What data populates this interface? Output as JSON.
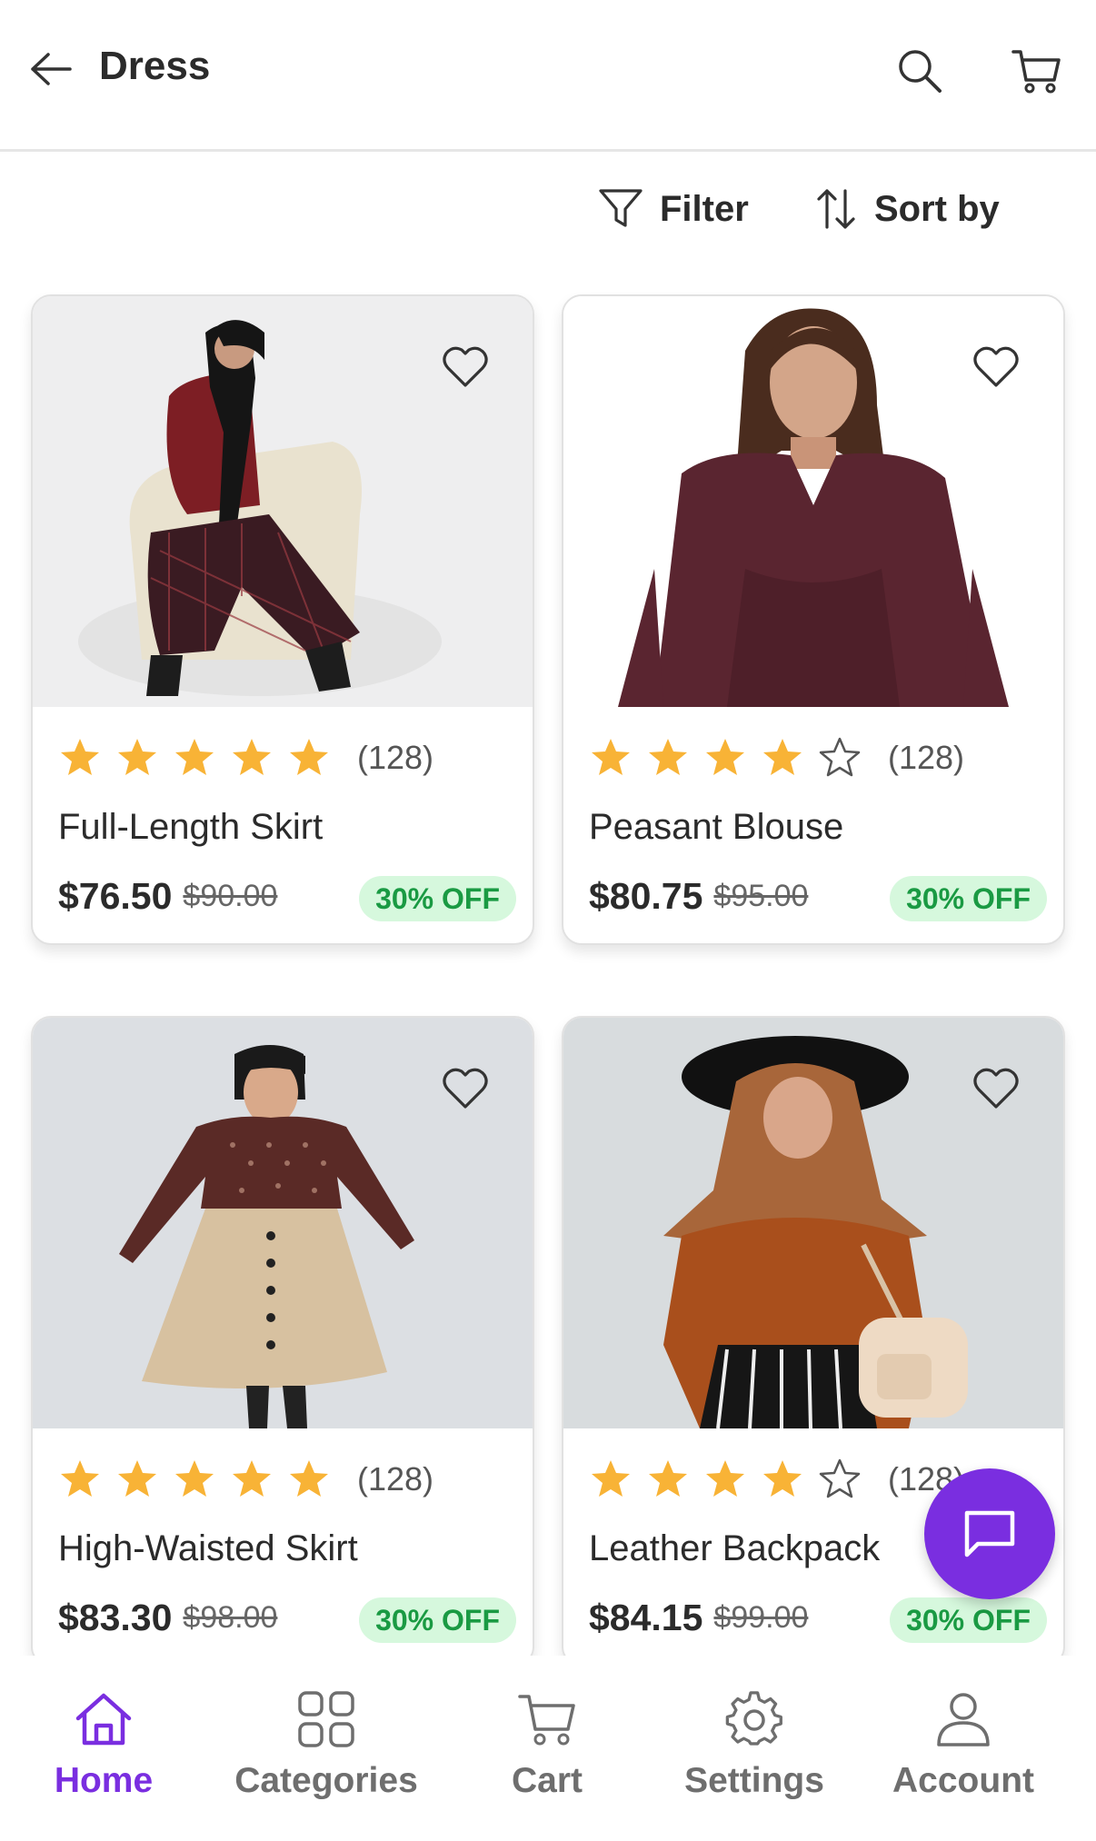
{
  "header": {
    "title": "Dress",
    "back_icon": "arrow-left-icon",
    "search_icon": "search-icon",
    "cart_icon": "cart-icon"
  },
  "toolbar": {
    "filter_label": "Filter",
    "sort_label": "Sort by"
  },
  "colors": {
    "accent": "#7a2ee0",
    "star": "#f8b336",
    "badge_bg": "#d6f8dd",
    "badge_text": "#1a9a43"
  },
  "products": [
    {
      "name": "Full-Length Skirt",
      "rating": 5,
      "reviews": "(128)",
      "price": "$76.50",
      "old_price": "$90.00",
      "discount": "30% OFF"
    },
    {
      "name": "Peasant Blouse",
      "rating": 4,
      "reviews": "(128)",
      "price": "$80.75",
      "old_price": "$95.00",
      "discount": "30% OFF"
    },
    {
      "name": "High-Waisted Skirt",
      "rating": 5,
      "reviews": "(128)",
      "price": "$83.30",
      "old_price": "$98.00",
      "discount": "30% OFF"
    },
    {
      "name": "Leather Backpack",
      "rating": 4,
      "reviews": "(128)",
      "price": "$84.15",
      "old_price": "$99.00",
      "discount": "30% OFF"
    }
  ],
  "nav": [
    {
      "label": "Home",
      "icon": "home-icon",
      "active": true
    },
    {
      "label": "Categories",
      "icon": "grid-icon",
      "active": false
    },
    {
      "label": "Cart",
      "icon": "cart-icon",
      "active": false
    },
    {
      "label": "Settings",
      "icon": "gear-icon",
      "active": false
    },
    {
      "label": "Account",
      "icon": "user-icon",
      "active": false
    }
  ],
  "fab": {
    "icon": "chat-icon"
  }
}
